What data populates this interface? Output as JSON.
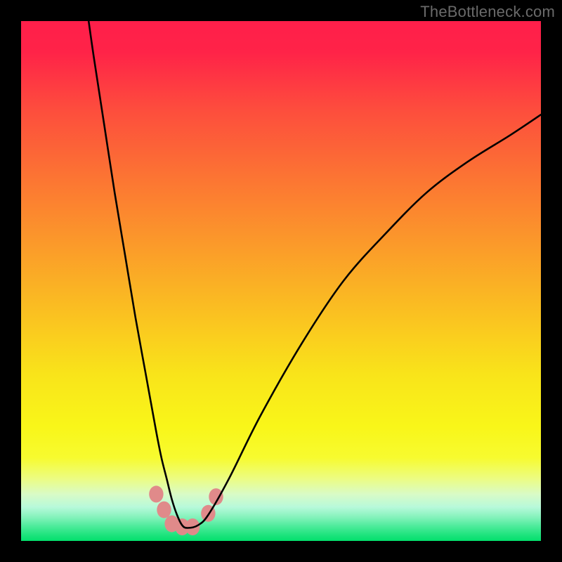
{
  "watermark": "TheBottleneck.com",
  "chart_data": {
    "type": "line",
    "title": "",
    "xlabel": "",
    "ylabel": "",
    "xlim": [
      0,
      100
    ],
    "ylim": [
      0,
      100
    ],
    "background_gradient_stops": [
      {
        "offset": 0.0,
        "color": "#ff1f4a"
      },
      {
        "offset": 0.06,
        "color": "#ff2348"
      },
      {
        "offset": 0.17,
        "color": "#fd4d3d"
      },
      {
        "offset": 0.3,
        "color": "#fc7433"
      },
      {
        "offset": 0.43,
        "color": "#fb9a2a"
      },
      {
        "offset": 0.56,
        "color": "#fac021"
      },
      {
        "offset": 0.68,
        "color": "#f9e41a"
      },
      {
        "offset": 0.78,
        "color": "#f9f619"
      },
      {
        "offset": 0.84,
        "color": "#f7fb2f"
      },
      {
        "offset": 0.88,
        "color": "#ecfc82"
      },
      {
        "offset": 0.91,
        "color": "#d9fbc6"
      },
      {
        "offset": 0.935,
        "color": "#b7f9da"
      },
      {
        "offset": 0.955,
        "color": "#82f2ba"
      },
      {
        "offset": 0.972,
        "color": "#4ceb9a"
      },
      {
        "offset": 0.988,
        "color": "#1fe47e"
      },
      {
        "offset": 1.0,
        "color": "#02df6c"
      }
    ],
    "series": [
      {
        "name": "bottleneck-curve",
        "stroke": "#000000",
        "stroke_width": 2.6,
        "x": [
          13,
          14,
          16,
          18,
          20,
          22,
          24,
          26,
          27,
          28,
          29,
          30,
          31,
          32,
          34,
          36,
          40,
          46,
          54,
          62,
          70,
          78,
          86,
          94,
          100
        ],
        "y": [
          100,
          93,
          80,
          67,
          55,
          43,
          32,
          21,
          16,
          12,
          8,
          5,
          3,
          2.5,
          3,
          5,
          12,
          24,
          38,
          50,
          59,
          67,
          73,
          78,
          82
        ]
      }
    ],
    "markers": {
      "name": "highlight-dots",
      "color": "#e08a8a",
      "radius": 12,
      "points": [
        {
          "x": 26.0,
          "y": 9.0
        },
        {
          "x": 27.5,
          "y": 6.0
        },
        {
          "x": 29.0,
          "y": 3.3
        },
        {
          "x": 31.0,
          "y": 2.7
        },
        {
          "x": 33.0,
          "y": 2.7
        },
        {
          "x": 36.0,
          "y": 5.3
        },
        {
          "x": 37.5,
          "y": 8.5
        }
      ]
    }
  }
}
